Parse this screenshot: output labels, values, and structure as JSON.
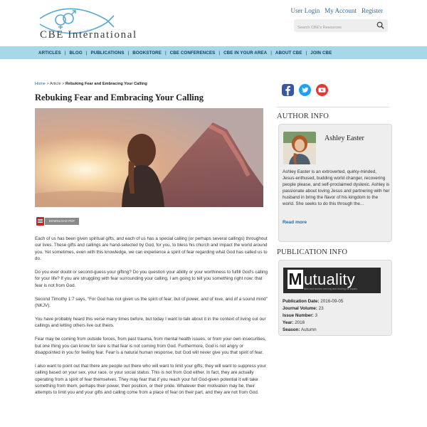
{
  "header": {
    "logo_text": "CBE International",
    "user_links": [
      "User Login",
      "My Account",
      "Register"
    ],
    "search_placeholder": "Search CBE's Resources"
  },
  "nav": {
    "items": [
      "ARTICLES",
      "BLOG",
      "PUBLICATIONS",
      "BOOKSTORE",
      "CBE CONFERENCES",
      "CBE IN YOUR AREA",
      "ABOUT CBE",
      "JOIN CBE"
    ],
    "separator": "|"
  },
  "breadcrumb": {
    "home": "Home",
    "sep": ">",
    "section": "Article",
    "current": "Rebuking Fear and Embracing Your Calling"
  },
  "article": {
    "title": "Rebuking Fear and Embracing Your Calling",
    "download_label": "DOWNLOAD PDF",
    "paragraphs": [
      "Each of us has been given spiritual gifts, and each of us has a special calling (or perhaps several callings) throughout our lives. These gifts and callings are hand-selected by God, for you, to bless his church and impact the world around you. Yet sometimes, even with this knowledge, we can experience a spirit of fear regarding what God has called us to do.",
      "Do you ever doubt or second-guess your gifting? Do you question your ability or your worthiness to fulfill God's calling for your life? If you are struggling with fear surrounding your calling, I am going to tell you something right now: that fear is not from God.",
      "Second Timothy 1:7 says, \"For God has not given us the spirit of fear; but of power, and of love, and of a sound mind\" (NKJV).",
      "You have probably heard this verse many times before, but today I want to talk about it in the context of living out our callings and letting others live out theirs.",
      "Fear may be coming from outside forces, from past trauma, from mental health issues, or from your own insecurities, but one thing you can know for sure is that fear is not coming from God. Furthermore, God is not angry or disappointed in you for feeling fear. Fear is a natural human response, but God will never give you that spirit of fear.",
      "I also want to point out that there are people out there who will want to limit your gifts; they will want to suppress your calling based on your sex, your race, or your social status. This is not from God either. In fact, they are actually operating from a spirit of fear themselves. They may fear that if you reach your full God-given potential it will take something from them, perhaps their power, their position, or their pride. Whatever their motivation may be, their attempts to limit you and your gifts and calling come from a place of fear on their part, and they are not from God."
    ]
  },
  "sidebar": {
    "social": [
      "facebook-icon",
      "twitter-icon",
      "youtube-icon"
    ],
    "author_heading": "AUTHOR INFO",
    "author_name": "Ashley Easter",
    "author_bio": "Ashley Easter is an extroverted, quirky-minded, Jesus-enthused, budding world changer, recovering people please, and self-proclaimed dyslexic. Ashley is passionate about loving Jesus and partnering with her husband in bring the flavor of his kingdom to the world. She seeks to do this through the...",
    "read_more": "Read more",
    "pub_heading": "PUBLICATION INFO",
    "masthead": {
      "initial": "M",
      "rest": "utuality",
      "tagline": "Men and women serving and leading as equals"
    },
    "pub_fields": [
      {
        "label": "Publication Date:",
        "value": "2016-09-05"
      },
      {
        "label": "Journal Volume:",
        "value": "23"
      },
      {
        "label": "Issue Number:",
        "value": "3"
      },
      {
        "label": "Year:",
        "value": "2016"
      },
      {
        "label": "Season:",
        "value": "Autumn"
      }
    ]
  },
  "colors": {
    "nav_bg": "#a6d8ea",
    "link": "#2c6aa0",
    "facebook": "#3b5998",
    "twitter": "#1da1f2",
    "youtube": "#e53935"
  }
}
